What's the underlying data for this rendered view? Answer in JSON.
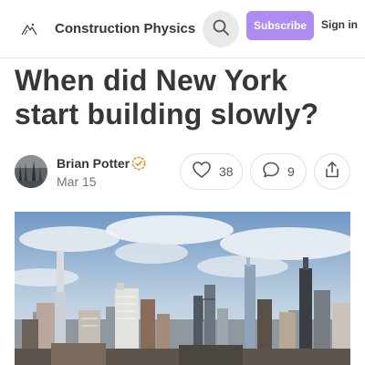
{
  "header": {
    "publication_name": "Construction Physics",
    "subscribe_label": "Subscribe",
    "signin_label": "Sign in",
    "icons": {
      "logo": "construction-physics-logo-icon",
      "search": "search-icon"
    }
  },
  "post": {
    "title": "When did New York start building slowly?",
    "author": "Brian Potter",
    "date": "Mar 15",
    "likes": "38",
    "comments": "9",
    "icons": {
      "verified": "verified-check-icon",
      "like": "heart-icon",
      "comment": "comment-bubble-icon",
      "share": "share-icon"
    }
  },
  "colors": {
    "accent": "#ad8bf0",
    "verified": "#f08c2a",
    "text": "#363737",
    "muted": "#757575"
  }
}
